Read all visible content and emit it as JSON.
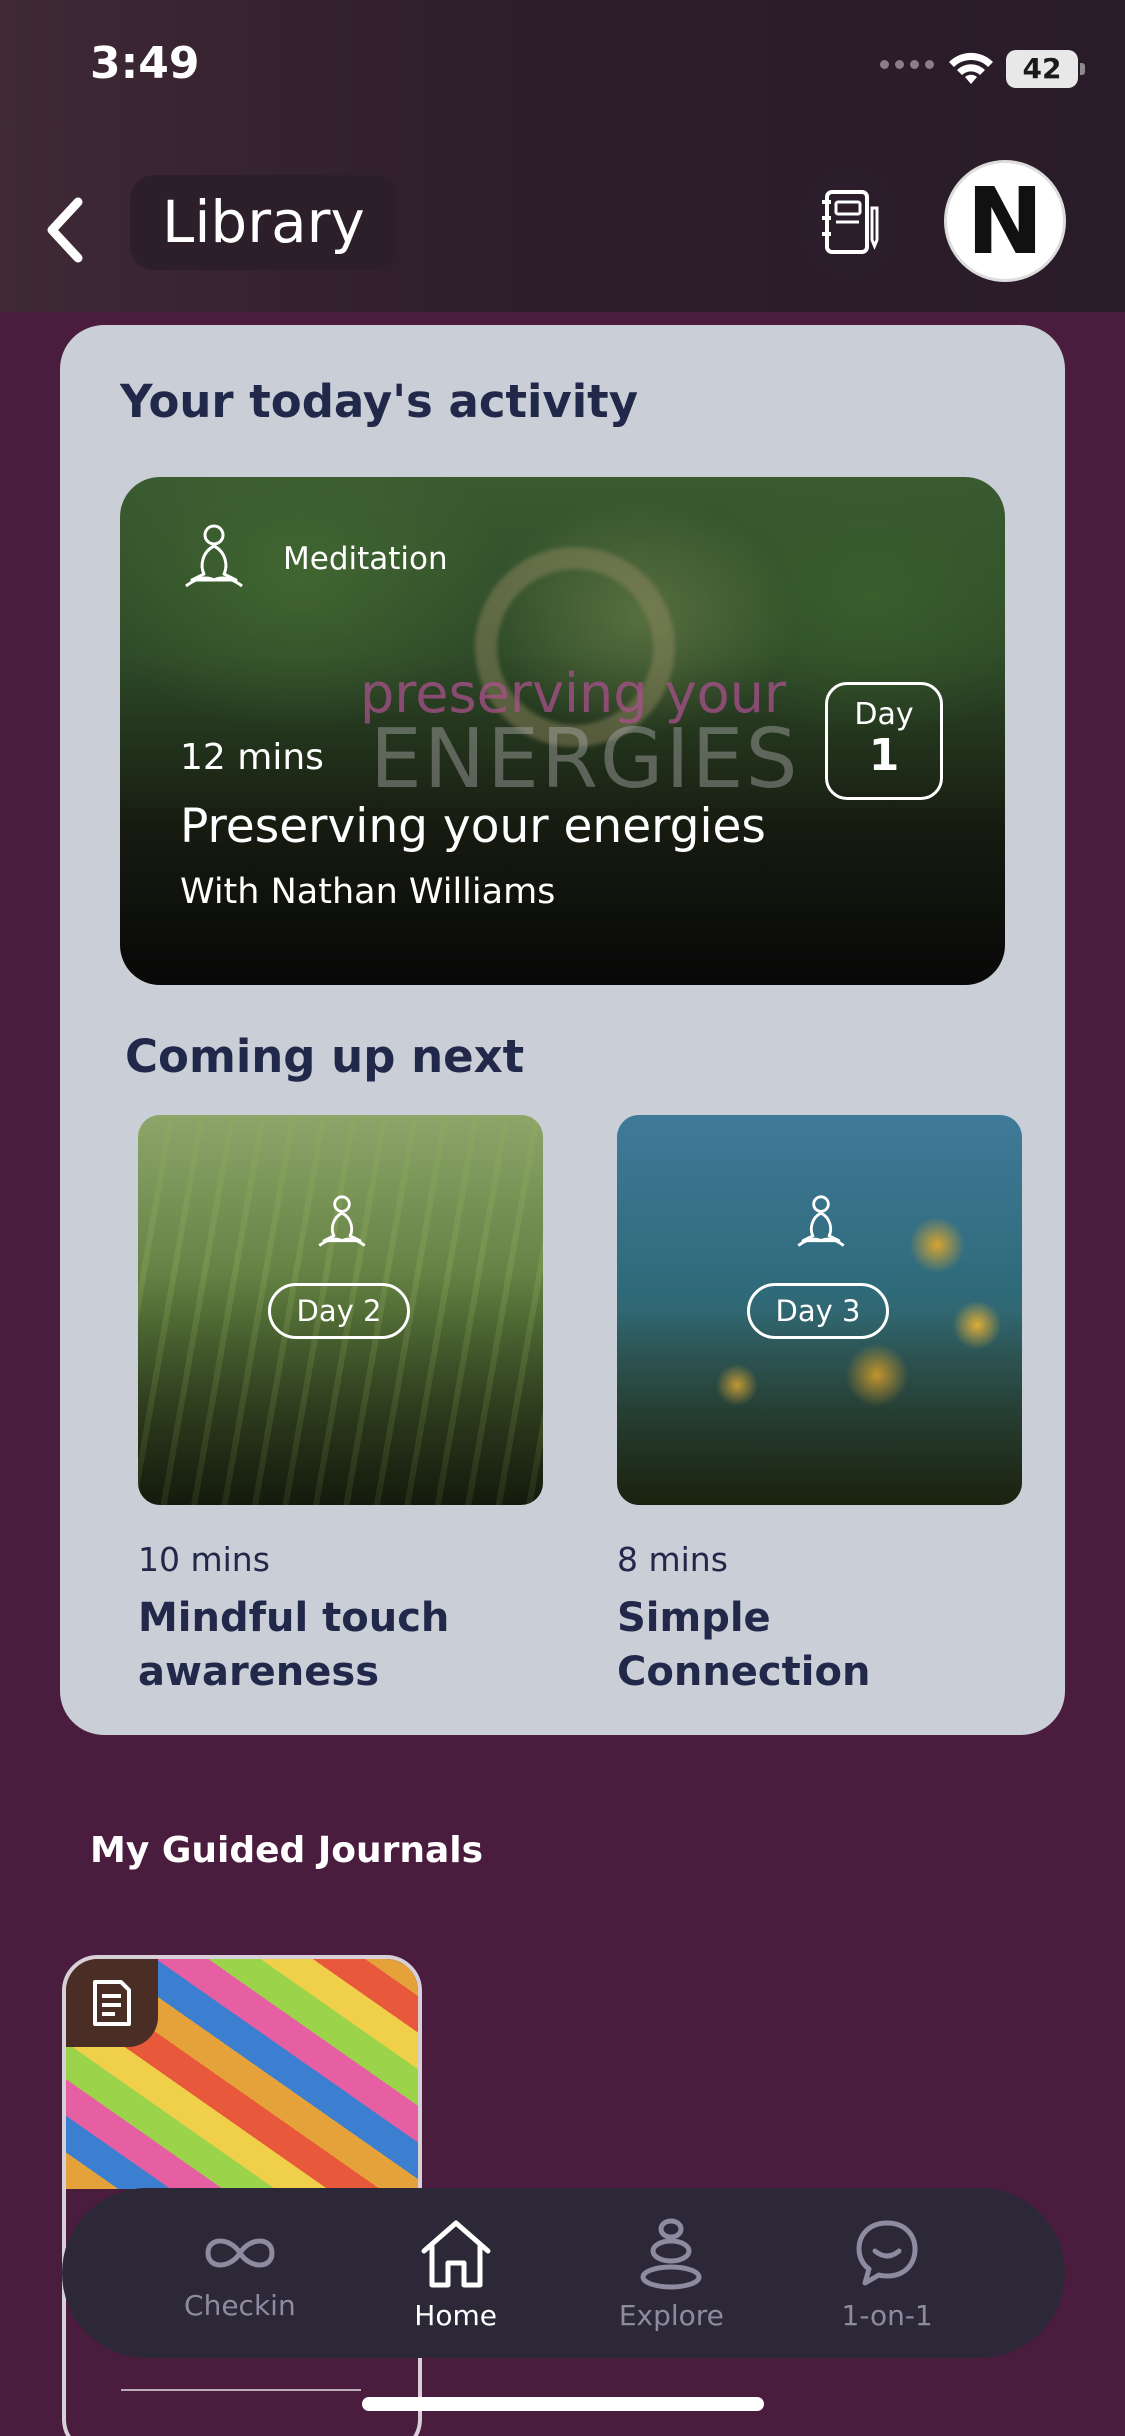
{
  "status": {
    "time": "3:49",
    "battery": "42"
  },
  "header": {
    "title": "Library",
    "back_icon": "chevron-left-icon",
    "journal_icon": "notebook-icon",
    "avatar_letter": "N"
  },
  "today": {
    "title": "Your today's activity",
    "category": "Meditation",
    "watermark_line1": "preserving your",
    "watermark_line2": "ENERGIES",
    "duration": "12 mins",
    "activity_title": "Preserving your energies",
    "author": "With Nathan Williams",
    "day_label": "Day",
    "day_number": "1"
  },
  "next": {
    "title": "Coming up next",
    "items": [
      {
        "day": "Day 2",
        "duration": "10 mins",
        "title": "Mindful touch awareness"
      },
      {
        "day": "Day 3",
        "duration": "8 mins",
        "title": "Simple Connection"
      }
    ]
  },
  "journals": {
    "title": "My Guided Journals"
  },
  "tabs": [
    {
      "label": "Checkin",
      "icon": "infinity-icon"
    },
    {
      "label": "Home",
      "icon": "home-icon"
    },
    {
      "label": "Explore",
      "icon": "stones-icon"
    },
    {
      "label": "1-on-1",
      "icon": "chat-icon"
    }
  ],
  "colors": {
    "background": "#4a1d3e",
    "card": "#c9ced7",
    "text_dark": "#22284a",
    "tabbar": "#2d2838"
  }
}
